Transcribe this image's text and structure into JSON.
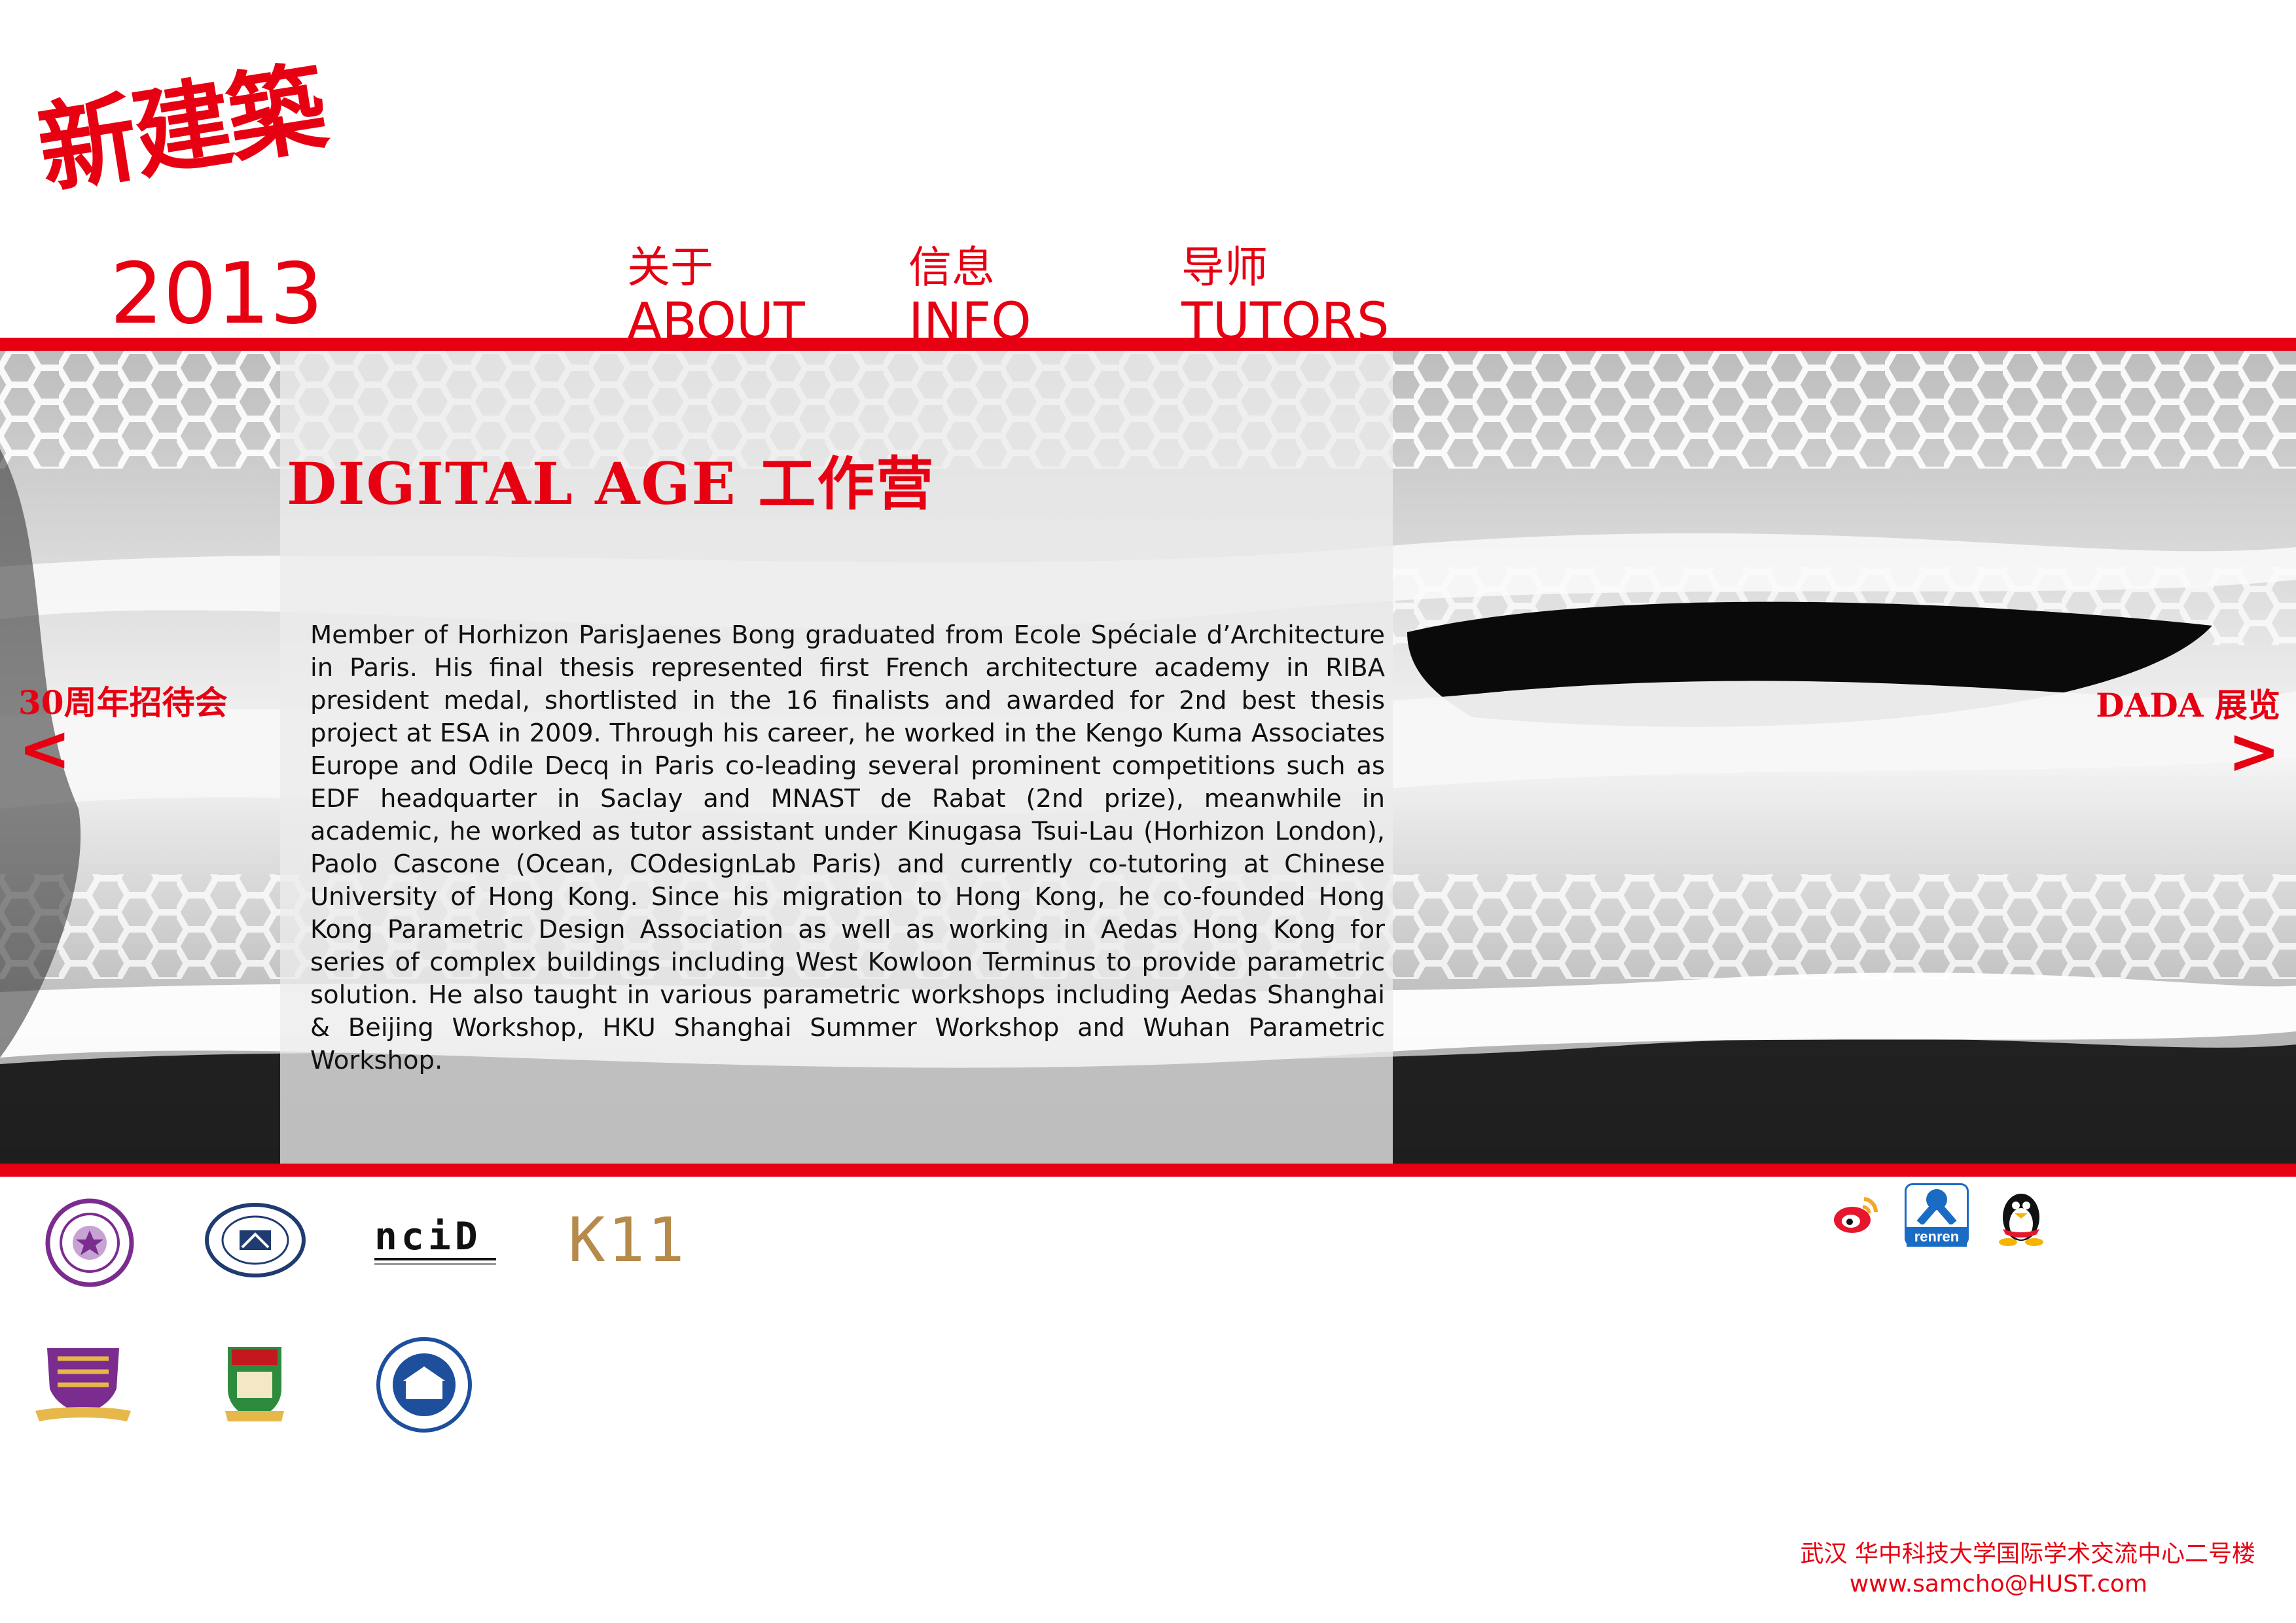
{
  "brand": {
    "logo_text": "新建築",
    "year": "2013"
  },
  "nav": [
    {
      "cn": "关于",
      "en": "ABOUT"
    },
    {
      "cn": "信息",
      "en": "INFO"
    },
    {
      "cn": "导师",
      "en": "TUTORS"
    }
  ],
  "hero": {
    "title": "DIGITAL AGE 工作营",
    "body": "Member of Horhizon ParisJaenes Bong graduated from Ecole Spéciale d’Architecture in Paris. His final thesis represented first French architecture academy in RIBA president medal, shortlisted in the 16 finalists and awarded for 2nd best thesis project at ESA in 2009. Through his career, he worked in the Kengo Kuma Associates Europe and Odile Decq in Paris co-leading several prominent competitions such as EDF headquarter in Saclay and MNAST de Rabat (2nd prize), meanwhile in academic, he worked as tutor assistant under Kinugasa Tsui-Lau (Horhizon London), Paolo Cascone (Ocean, COdesignLab Paris) and currently co-tutoring at Chinese University of Hong Kong. Since his migration to Hong Kong, he co-founded Hong Kong Parametric Design Associa­tion as well as working in Aedas Hong Kong for series of complex buildings in­cluding West Kowloon Terminus to provide parametric solution. He also taught in various parametric workshops including Aedas Shanghai & Beijing Work­shop, HKU Shanghai Summer Workshop and Wuhan Parametric Workshop.",
    "prev": {
      "label": "30周年招待会",
      "arrow": "<"
    },
    "next": {
      "label": "DADA 展览",
      "arrow": ">"
    }
  },
  "partners": {
    "k11": "K11",
    "ncid": "nciD"
  },
  "social": {
    "renren": "renren"
  },
  "footer": {
    "address": "武汉 华中科技大学国际学术交流中心二号楼",
    "email": "www.samcho@HUST.com"
  },
  "colors": {
    "accent": "#e60012",
    "overlay": "#ececec",
    "text": "#111111"
  }
}
